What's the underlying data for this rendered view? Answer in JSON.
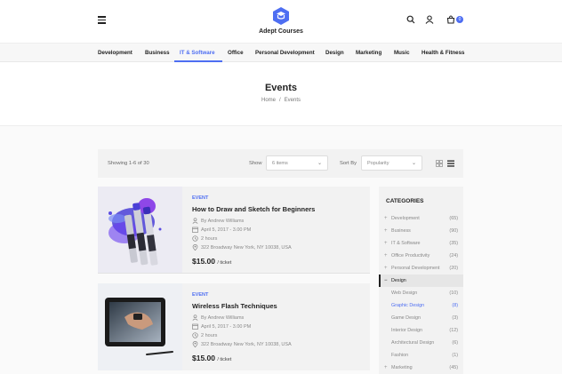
{
  "header": {
    "brand": "Adept Courses",
    "cart_count": "0",
    "accent": "#4e6ef2"
  },
  "nav": {
    "items": [
      "Development",
      "Business",
      "IT & Software",
      "Office",
      "Personal Development",
      "Design",
      "Marketing",
      "Music",
      "Health & Fitness"
    ],
    "active": "IT & Software"
  },
  "page": {
    "title": "Events",
    "breadcrumb": [
      "Home",
      "Events"
    ],
    "breadcrumb_sep": "/"
  },
  "toolbar": {
    "showing": "Showing 1-6 of 30",
    "show_label": "Show",
    "show_value": "6 items",
    "sort_label": "Sort By",
    "sort_value": "Popularity"
  },
  "events": [
    {
      "tag": "Event",
      "title": "How to Draw and Sketch for Beginners",
      "author": "By Andrew Williams",
      "date": "April 5, 2017 - 3.00 PM",
      "duration": "2 hours",
      "location": "322 Broadway New York, NY 10038, USA",
      "price": "$15.00",
      "per": "/ ticket"
    },
    {
      "tag": "Event",
      "title": "Wireless Flash Techniques",
      "author": "By Andrew Williams",
      "date": "April 5, 2017 - 3.00 PM",
      "duration": "2 hours",
      "location": "322 Broadway New York, NY 10038, USA",
      "price": "$15.00",
      "per": "/ ticket"
    }
  ],
  "sidebar": {
    "title": "CATEGORIES",
    "categories": [
      {
        "name": "Development",
        "count": "(65)",
        "sign": "+"
      },
      {
        "name": "Business",
        "count": "(90)",
        "sign": "+"
      },
      {
        "name": "IT & Software",
        "count": "(35)",
        "sign": "+"
      },
      {
        "name": "Office Productivity",
        "count": "(24)",
        "sign": "+"
      },
      {
        "name": "Personal Development",
        "count": "(20)",
        "sign": "+"
      },
      {
        "name": "Design",
        "count": "",
        "sign": "−"
      },
      {
        "name": "Web Design",
        "count": "(10)",
        "sign": ""
      },
      {
        "name": "Graphic Design",
        "count": "(8)",
        "sign": ""
      },
      {
        "name": "Game Design",
        "count": "(3)",
        "sign": ""
      },
      {
        "name": "Interior Design",
        "count": "(12)",
        "sign": ""
      },
      {
        "name": "Architectural Design",
        "count": "(6)",
        "sign": ""
      },
      {
        "name": "Fashion",
        "count": "(1)",
        "sign": ""
      },
      {
        "name": "Marketing",
        "count": "(45)",
        "sign": "+"
      }
    ]
  }
}
